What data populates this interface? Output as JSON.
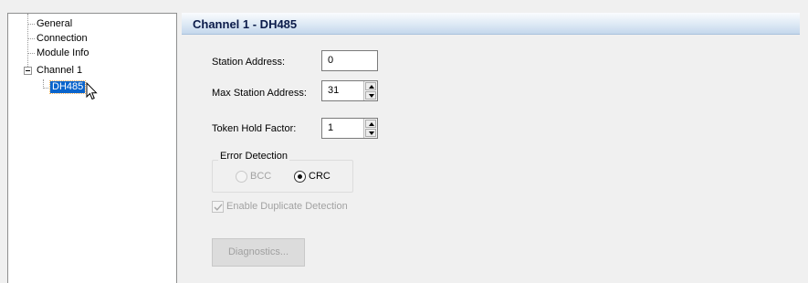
{
  "tree": {
    "items": [
      {
        "label": "General"
      },
      {
        "label": "Connection"
      },
      {
        "label": "Module Info"
      },
      {
        "label": "Channel 1"
      },
      {
        "label": "DH485",
        "selected": true
      }
    ]
  },
  "header": {
    "title": "Channel 1 - DH485"
  },
  "form": {
    "station_address": {
      "label": "Station Address:",
      "value": "0"
    },
    "max_station_address": {
      "label": "Max Station Address:",
      "value": "31"
    },
    "token_hold_factor": {
      "label": "Token Hold Factor:",
      "value": "1"
    },
    "error_detection": {
      "label": "Error Detection",
      "options": [
        {
          "label": "BCC",
          "selected": false,
          "enabled": false
        },
        {
          "label": "CRC",
          "selected": true,
          "enabled": true
        }
      ]
    },
    "duplicate_detection": {
      "label": "Enable Duplicate Detection",
      "checked": true,
      "enabled": false
    },
    "diagnostics_button": {
      "label": "Diagnostics...",
      "enabled": false
    }
  },
  "colors": {
    "selection": "#0a64cc",
    "header_text": "#0b1b4a"
  }
}
